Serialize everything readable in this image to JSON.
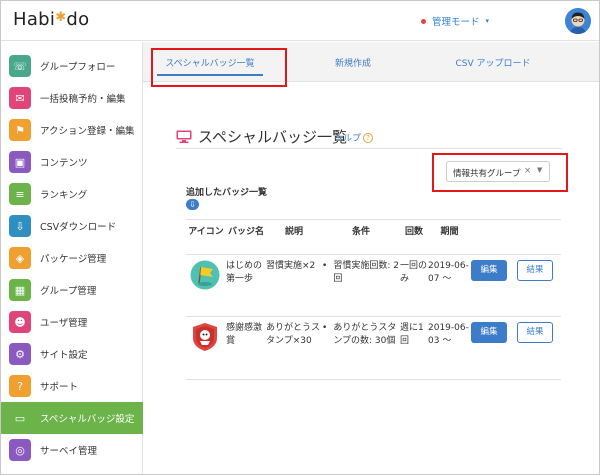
{
  "header": {
    "logo": "Habi*do",
    "mode_label": "管理モード",
    "mode_caret": "▾"
  },
  "sidebar": {
    "items": [
      {
        "label": "グループフォロー",
        "icon": "group-follow-icon",
        "color": "#4aa88a",
        "glyph": "☏"
      },
      {
        "label": "一括投稿予約・編集",
        "icon": "chat-icon",
        "color": "#e0457a",
        "glyph": "✉"
      },
      {
        "label": "アクション登録・編集",
        "icon": "flag-icon",
        "color": "#f0a030",
        "glyph": "⚑"
      },
      {
        "label": "コンテンツ",
        "icon": "content-icon",
        "color": "#8a5ac0",
        "glyph": "▣"
      },
      {
        "label": "ランキング",
        "icon": "ranking-icon",
        "color": "#6cb34a",
        "glyph": "≡"
      },
      {
        "label": "CSVダウンロード",
        "icon": "download-icon",
        "color": "#2f8fc0",
        "glyph": "⇩"
      },
      {
        "label": "パッケージ管理",
        "icon": "package-icon",
        "color": "#f0a030",
        "glyph": "◈"
      },
      {
        "label": "グループ管理",
        "icon": "group-manage-icon",
        "color": "#6cb34a",
        "glyph": "▦"
      },
      {
        "label": "ユーザ管理",
        "icon": "user-manage-icon",
        "color": "#e0457a",
        "glyph": "☻"
      },
      {
        "label": "サイト設定",
        "icon": "gear-icon",
        "color": "#8a5ac0",
        "glyph": "⚙"
      },
      {
        "label": "サポート",
        "icon": "support-icon",
        "color": "#f0a030",
        "glyph": "?"
      },
      {
        "label": "スペシャルバッジ設定",
        "icon": "monitor-icon",
        "color": "#6cb34a",
        "glyph": "▭",
        "active": true
      },
      {
        "label": "サーベイ管理",
        "icon": "compass-icon",
        "color": "#8a5ac0",
        "glyph": "◎"
      }
    ]
  },
  "tabs": {
    "list": "スペシャルバッジ一覧",
    "create": "新規作成",
    "csv": "CSV アップロード"
  },
  "main": {
    "title": "スペシャルバッジ一覧",
    "help": "ヘルプ",
    "help_mark": "?",
    "group_select": "情報共有グループ",
    "clear_mark": "×",
    "added_heading": "追加したバッジ一覧",
    "columns": {
      "icon": "アイコン",
      "badge_name": "バッジ名",
      "desc": "説明",
      "cond": "条件",
      "count": "回数",
      "period": "期間"
    },
    "rows": [
      {
        "name": "はじめの第一歩",
        "desc": "習慣実施×2",
        "cond": "習慣実施回数: 2回",
        "count": "一回のみ",
        "period": "2019-06-07 〜",
        "edit": "編集",
        "result": "結果"
      },
      {
        "name": "感謝感激賞",
        "desc": "ありがとうスタンプ×30",
        "cond": "ありがとうスタンプの数: 30個",
        "count": "週に1回",
        "period": "2019-06-03 〜",
        "edit": "編集",
        "result": "結果"
      }
    ]
  },
  "colors": {
    "accent": "#3d7cc9",
    "active_sidebar": "#6cb34a",
    "highlight_box": "#e41818",
    "mode_dot": "#e0453f"
  }
}
